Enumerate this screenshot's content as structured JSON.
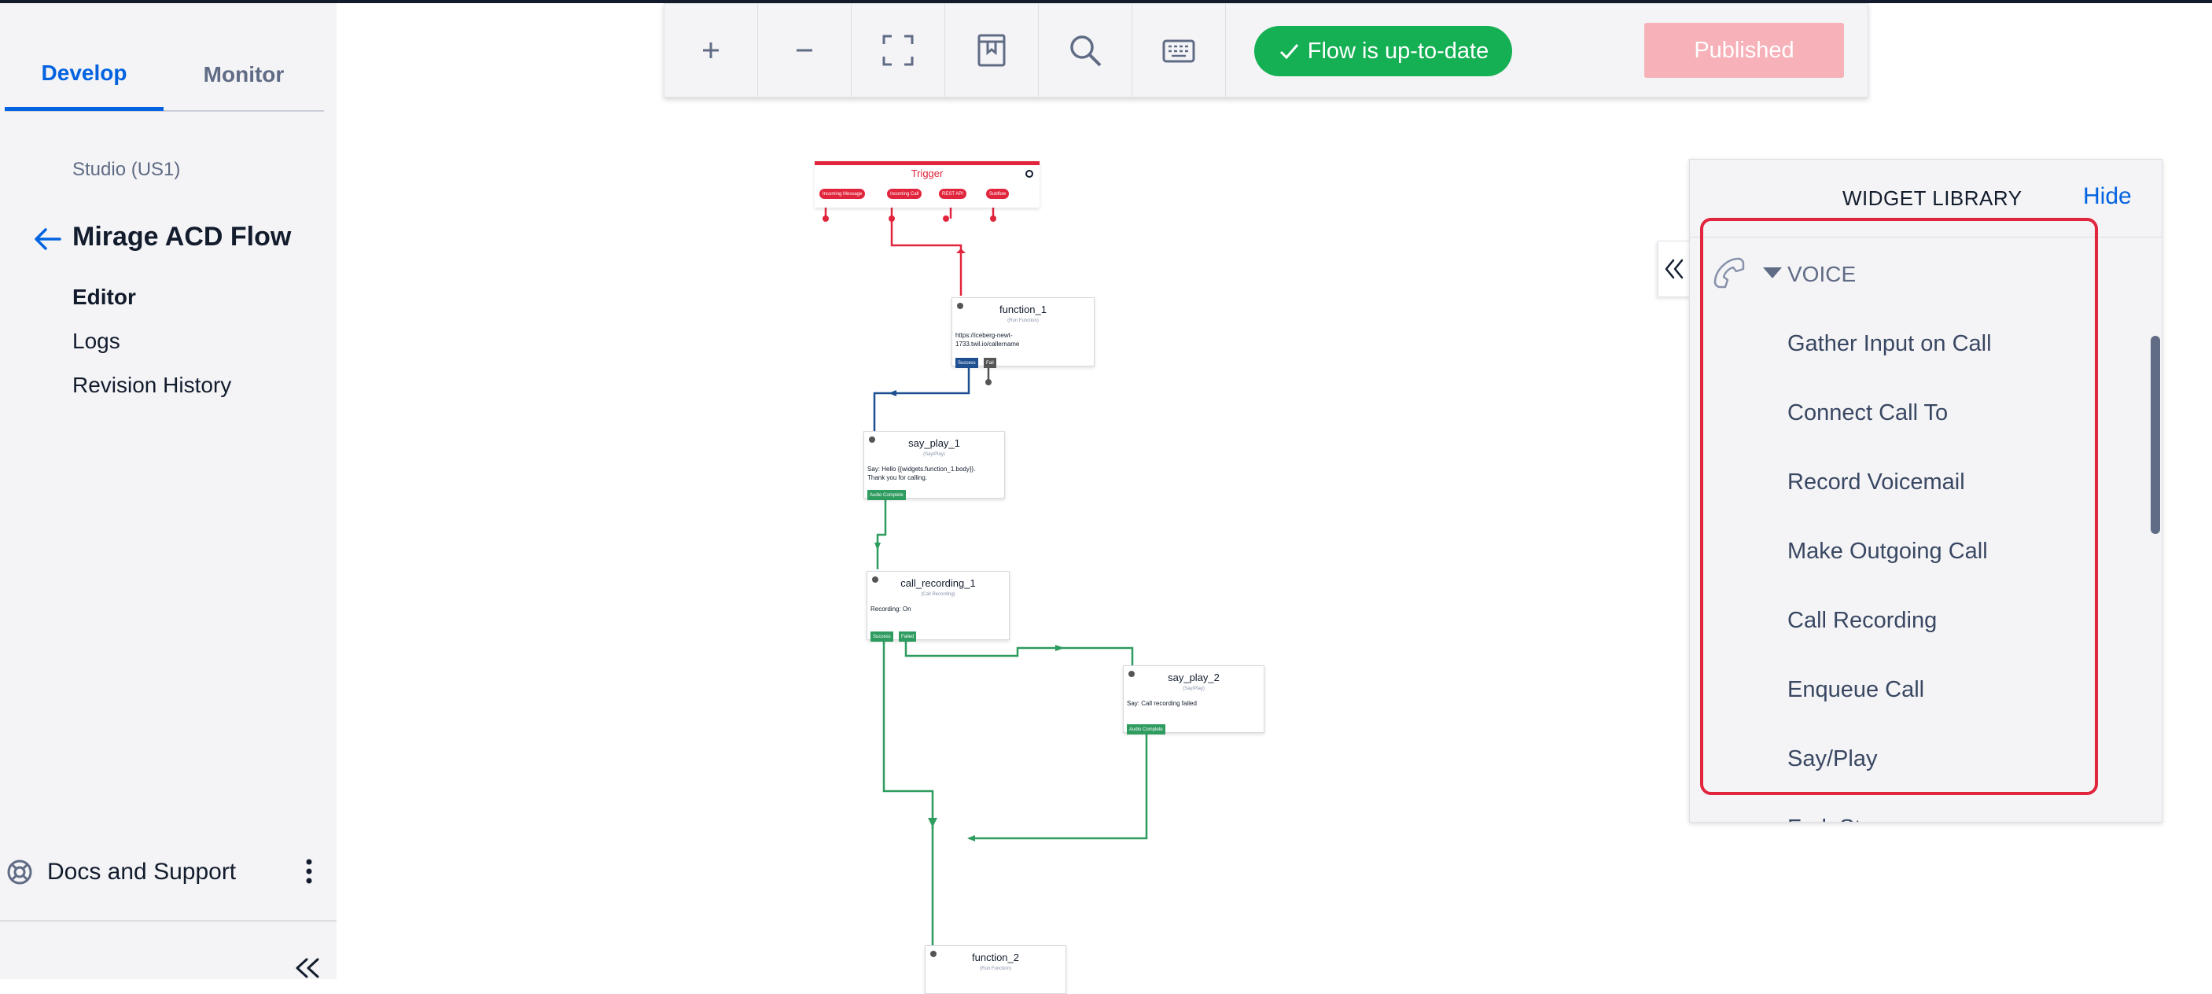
{
  "sidebar": {
    "tabs": [
      {
        "label": "Develop"
      },
      {
        "label": "Monitor"
      }
    ],
    "studio_label": "Studio (US1)",
    "flow_name": "Mirage ACD Flow",
    "nav": [
      {
        "label": "Editor"
      },
      {
        "label": "Logs"
      },
      {
        "label": "Revision History"
      }
    ],
    "docs_label": "Docs and Support"
  },
  "toolbar": {
    "status": "Flow is up-to-date",
    "publish_label": "Published"
  },
  "flow": {
    "trigger": {
      "name": "Trigger",
      "ports": [
        "Incoming Message",
        "Incoming Call",
        "REST API",
        "Subflow"
      ]
    },
    "nodes": {
      "function_1": {
        "name": "function_1",
        "type": "(Run Function)",
        "body": [
          "https://iceberg-newt-",
          "1733.twil.io/callername"
        ],
        "ports": [
          "Success",
          "Fail"
        ]
      },
      "say_play_1": {
        "name": "say_play_1",
        "type": "(Say/Play)",
        "body": [
          "Say: Hello {{widgets.function_1.body}}.",
          "Thank you for calling."
        ],
        "ports": [
          "Audio Complete"
        ]
      },
      "call_recording_1": {
        "name": "call_recording_1",
        "type": "(Call Recording)",
        "body": [
          "Recording: On"
        ],
        "ports": [
          "Success",
          "Failed"
        ]
      },
      "say_play_2": {
        "name": "say_play_2",
        "type": "(Say/Play)",
        "body": [
          "Say: Call recording failed"
        ],
        "ports": [
          "Audio Complete"
        ]
      },
      "function_2": {
        "name": "function_2",
        "type": "(Run Function)"
      }
    }
  },
  "library": {
    "title": "WIDGET LIBRARY",
    "hide_label": "Hide",
    "section": "VOICE",
    "items": [
      {
        "label": "Gather Input on Call"
      },
      {
        "label": "Connect Call To"
      },
      {
        "label": "Record Voicemail"
      },
      {
        "label": "Make Outgoing Call"
      },
      {
        "label": "Call Recording"
      },
      {
        "label": "Enqueue Call"
      },
      {
        "label": "Say/Play"
      },
      {
        "label": "Fork Stream"
      }
    ]
  },
  "colors": {
    "accent": "#0263e0",
    "success": "#14b053",
    "publish_disabled": "#f6b1b9",
    "trigger": "#e1253c",
    "highlight": "#e1253c",
    "wire_success_blue": "#1d4f91",
    "wire_green": "#2e9b5f"
  }
}
